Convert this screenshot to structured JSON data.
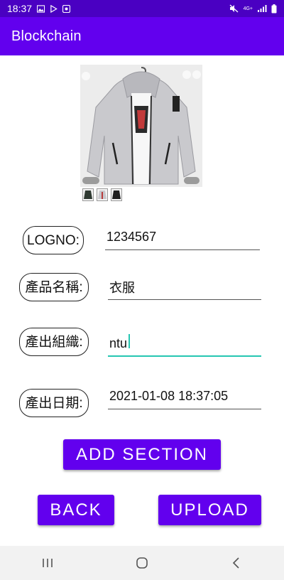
{
  "status_bar": {
    "time": "18:37",
    "network": "4G+",
    "icons": [
      "gallery-icon",
      "play-store-icon",
      "notification-icon",
      "mute-icon",
      "signal-icon",
      "battery-icon"
    ]
  },
  "app_bar": {
    "title": "Blockchain"
  },
  "product": {
    "image_icon": "jacket-image",
    "thumbnail_count": 3
  },
  "form": {
    "logno": {
      "label": "LOGNO:",
      "value": "1234567"
    },
    "product_name": {
      "label": "產品名稱:",
      "value": "衣服"
    },
    "organization": {
      "label": "產出組織:",
      "value": "ntu"
    },
    "date": {
      "label": "產出日期:",
      "value": "2021-01-08 18:37:05"
    }
  },
  "buttons": {
    "add_section": "ADD SECTION",
    "back": "BACK",
    "upload": "UPLOAD"
  },
  "nav_bar": {
    "icons": [
      "recent-apps-icon",
      "home-icon",
      "back-icon"
    ]
  },
  "colors": {
    "status_bar": "#4a00c2",
    "primary": "#6200ee",
    "accent": "#26c6b2",
    "nav_bar": "#f2f2f2"
  }
}
